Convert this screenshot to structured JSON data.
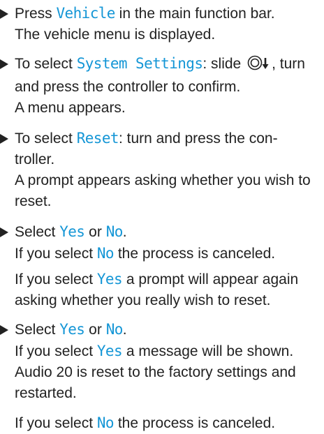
{
  "accent_color": "#1496d6",
  "text_color": "#222222",
  "steps": [
    {
      "pre": "Press ",
      "ui": "Vehicle",
      "post": " in the main function bar.",
      "result": "The vehicle menu is displayed."
    },
    {
      "pre": "To select ",
      "ui": "System Settings",
      "mid": ": slide ",
      "controller_icon": "controller-slide-down-icon",
      "post": ", turn and press the controller to confirm.",
      "result": "A menu appears."
    },
    {
      "pre": "To select ",
      "ui": "Reset",
      "post": ": turn and press the con-troller.",
      "result": "A prompt appears asking whether you wish to reset."
    },
    {
      "pre": "Select ",
      "ui_yes": "Yes",
      "or": " or ",
      "ui_no": "No",
      "end": ".",
      "line1_pre": "If you select ",
      "line1_ui": "No",
      "line1_post": " the process is canceled.",
      "line2_pre": "If you select ",
      "line2_ui": "Yes",
      "line2_post": " a prompt will appear again asking whether you really wish to reset."
    },
    {
      "pre": "Select ",
      "ui_yes": "Yes",
      "or": " or ",
      "ui_no": "No",
      "end": ".",
      "line1_pre": "If you select ",
      "line1_ui": "Yes",
      "line1_post": " a message will be shown. Audio 20 is reset to the factory settings and restarted."
    }
  ],
  "tail": {
    "pre": "If you select ",
    "ui": "No",
    "post": " the process is canceled."
  }
}
